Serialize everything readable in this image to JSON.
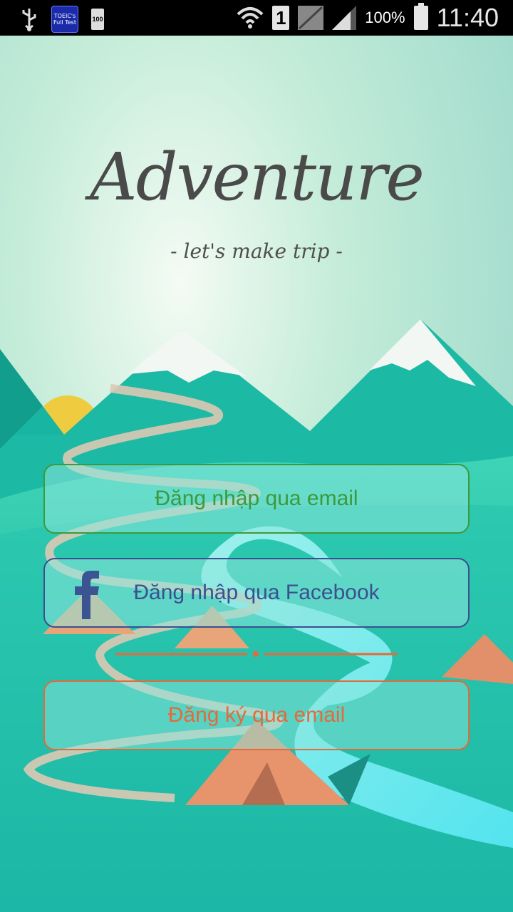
{
  "status_bar": {
    "app_icon_text": [
      "TOEIC's",
      "Full Test"
    ],
    "small_battery_text": "100",
    "sim_number": "1",
    "battery_percent": "100%",
    "time": "11:40"
  },
  "logo": {
    "title": "Adventure",
    "subtitle": "- let's make trip -"
  },
  "buttons": {
    "login_email": "Đăng nhập qua email",
    "login_facebook": "Đăng nhập qua Facebook",
    "register_email": "Đăng ký qua email"
  },
  "colors": {
    "email_green": "#3d9a3a",
    "facebook_blue": "#3c4f8f",
    "register_orange": "#e56a3a"
  }
}
